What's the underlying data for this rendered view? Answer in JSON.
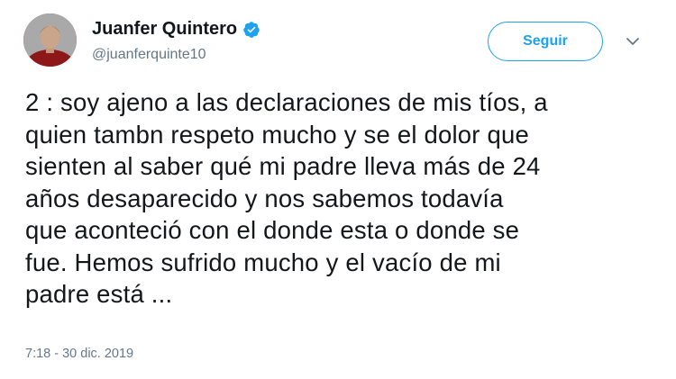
{
  "user": {
    "display_name": "Juanfer Quintero",
    "handle": "@juanferquinte10"
  },
  "follow_button": "Seguir",
  "tweet": {
    "text": "2 : soy ajeno a las declaraciones de mis tíos, a\nquien tambn respeto mucho y se el dolor que\nsienten al saber qué mi padre lleva más de 24\naños desaparecido y nos sabemos todavía\nque aconteció con el donde esta o donde se\nfue. Hemos sufrido mucho y el vacío de mi\npadre está ...",
    "timestamp": "7:18 - 30 dic. 2019"
  },
  "icons": {
    "verified": "verified-badge-icon",
    "menu": "chevron-down-icon"
  },
  "colors": {
    "accent": "#1da1f2",
    "secondary_text": "#657786",
    "primary_text": "#14171a"
  }
}
